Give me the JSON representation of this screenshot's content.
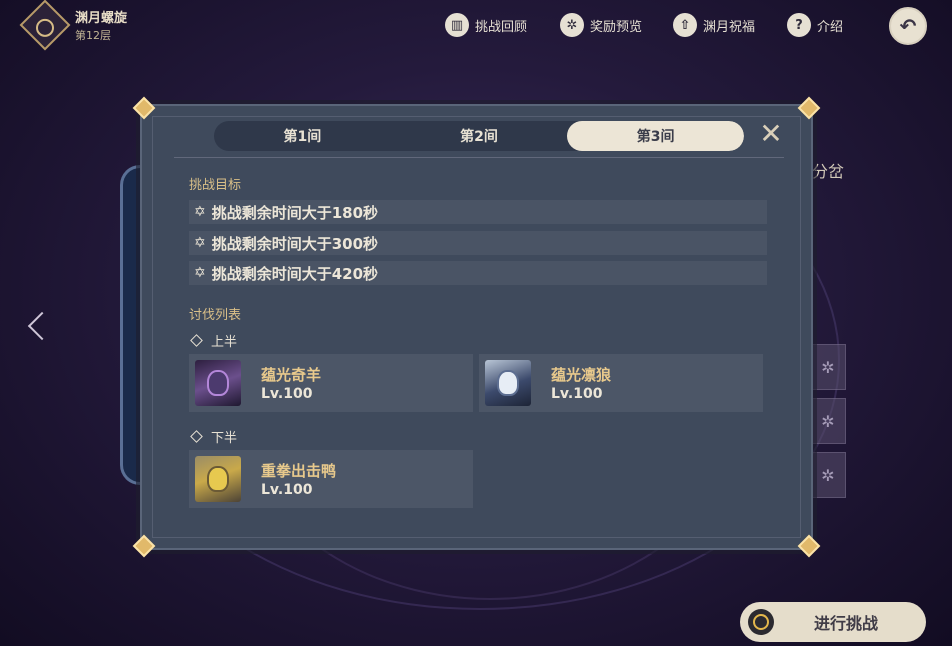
{
  "top": {
    "floor_title": "渊月螺旋",
    "floor_sub": "第12层",
    "nav": [
      {
        "icon": "book-icon",
        "label": "挑战回顾"
      },
      {
        "icon": "gear-star-icon",
        "label": "奖励预览"
      },
      {
        "icon": "arrow-up-icon",
        "label": "渊月祝福"
      },
      {
        "icon": "question-icon",
        "label": "介绍"
      }
    ],
    "back_icon": "back-arrow-icon"
  },
  "background": {
    "right_text": "分岔",
    "start_button": "进行挑战"
  },
  "modal": {
    "tabs": [
      "第1间",
      "第2间",
      "第3间"
    ],
    "active_tab": "第3间",
    "goals_title": "挑战目标",
    "goals": [
      "挑战剩余时间大于180秒",
      "挑战剩余时间大于300秒",
      "挑战剩余时间大于420秒"
    ],
    "enemies_title": "讨伐列表",
    "first_half": {
      "label": "上半",
      "enemies": [
        {
          "name": "蕴光奇羊",
          "level": "Lv.100"
        },
        {
          "name": "蕴光凛狼",
          "level": "Lv.100"
        }
      ]
    },
    "second_half": {
      "label": "下半",
      "enemies": [
        {
          "name": "重拳出击鸭",
          "level": "Lv.100"
        }
      ]
    }
  }
}
